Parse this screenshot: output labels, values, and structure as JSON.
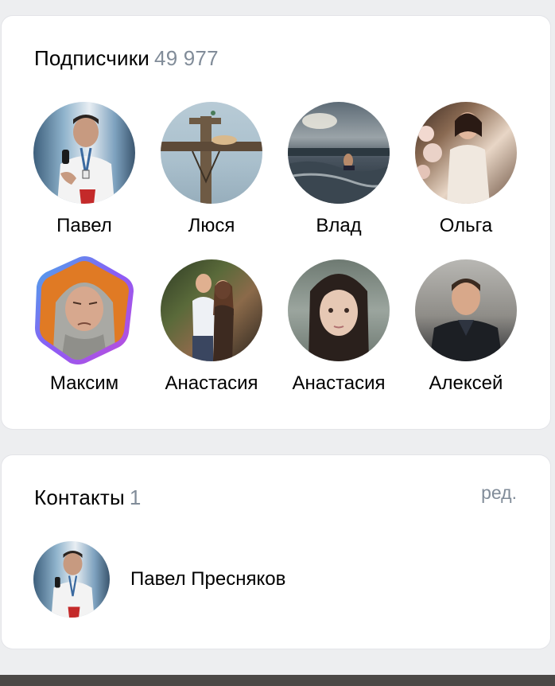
{
  "followers": {
    "title": "Подписчики",
    "count": "49 977",
    "people": [
      {
        "name": "Павел"
      },
      {
        "name": "Люся"
      },
      {
        "name": "Влад"
      },
      {
        "name": "Ольга"
      },
      {
        "name": "Максим"
      },
      {
        "name": "Анастасия"
      },
      {
        "name": "Анастасия"
      },
      {
        "name": "Алексей"
      }
    ]
  },
  "contacts": {
    "title": "Контакты",
    "count": "1",
    "edit_label": "ред.",
    "items": [
      {
        "name": "Павел Пресняков"
      }
    ]
  },
  "colors": {
    "accent_gradient": [
      "#4aa8e8",
      "#8b5cf6",
      "#c04cd8"
    ],
    "muted_text": "#818c99",
    "card_bg": "#ffffff",
    "page_bg": "#edeef0"
  }
}
